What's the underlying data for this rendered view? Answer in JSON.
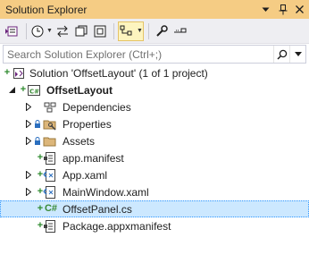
{
  "window": {
    "title": "Solution Explorer"
  },
  "search": {
    "placeholder": "Search Solution Explorer (Ctrl+;)"
  },
  "tree": {
    "solution": "Solution 'OffsetLayout' (1 of 1 project)",
    "project": "OffsetLayout",
    "dependencies": "Dependencies",
    "properties": "Properties",
    "assets": "Assets",
    "app_manifest": "app.manifest",
    "app_xaml": "App.xaml",
    "mainwindow_xaml": "MainWindow.xaml",
    "offsetpanel_cs": "OffsetPanel.cs",
    "package_manifest": "Package.appxmanifest"
  },
  "glyphs": {
    "plus": "+",
    "csharp": "C#"
  },
  "colors": {
    "title_bar": "#f5cc84",
    "selection": "#cce8ff",
    "git_added": "#2e8b2e",
    "folder": "#dcb67a"
  }
}
